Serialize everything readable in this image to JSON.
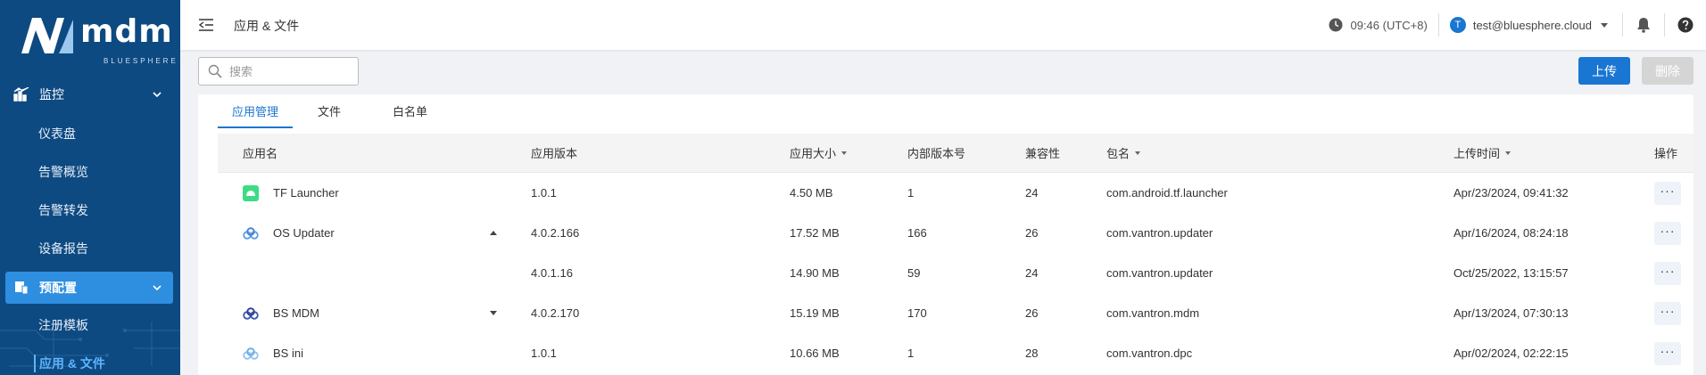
{
  "brand": {
    "name": "mdm",
    "sub": "BLUESPHERE"
  },
  "sidebar": {
    "groups": [
      {
        "label": "监控",
        "icon": "chart-icon"
      },
      {
        "label": "预配置",
        "icon": "config-icon"
      }
    ],
    "items": [
      "仪表盘",
      "告警概览",
      "告警转发",
      "设备报告",
      "注册模板",
      "应用 & 文件"
    ]
  },
  "header": {
    "title": "应用 & 文件",
    "time": "09:46 (UTC+8)",
    "user_initial": "T",
    "user_email": "test@bluesphere.cloud"
  },
  "toolbar": {
    "search_placeholder": "搜索",
    "upload_label": "上传",
    "delete_label": "删除"
  },
  "tabs": [
    "应用管理",
    "文件",
    "白名单"
  ],
  "table": {
    "columns": [
      "应用名",
      "应用版本",
      "应用大小",
      "内部版本号",
      "兼容性",
      "包名",
      "上传时间",
      "操作"
    ],
    "rows": [
      {
        "name": "TF Launcher",
        "icon": "android-icon",
        "version": "1.0.1",
        "size": "4.50 MB",
        "build": "1",
        "compat": "24",
        "package": "com.android.tf.launcher",
        "uploaded": "Apr/23/2024, 09:41:32",
        "expand": ""
      },
      {
        "name": "OS Updater",
        "icon": "cloud-icon",
        "version": "4.0.2.166",
        "size": "17.52 MB",
        "build": "166",
        "compat": "26",
        "package": "com.vantron.updater",
        "uploaded": "Apr/16/2024, 08:24:18",
        "expand": "up"
      },
      {
        "name": "",
        "icon": "",
        "version": "4.0.1.16",
        "size": "14.90 MB",
        "build": "59",
        "compat": "24",
        "package": "com.vantron.updater",
        "uploaded": "Oct/25/2022, 13:15:57",
        "expand": ""
      },
      {
        "name": "BS MDM",
        "icon": "cloud-icon",
        "version": "4.0.2.170",
        "size": "15.19 MB",
        "build": "170",
        "compat": "26",
        "package": "com.vantron.mdm",
        "uploaded": "Apr/13/2024, 07:30:13",
        "expand": "down"
      },
      {
        "name": "BS ini",
        "icon": "cloud-icon",
        "version": "1.0.1",
        "size": "10.66 MB",
        "build": "1",
        "compat": "28",
        "package": "com.vantron.dpc",
        "uploaded": "Apr/02/2024, 02:22:15",
        "expand": ""
      }
    ],
    "more_label": "···"
  },
  "colors": {
    "sidebar": "#0d4a82",
    "accent": "#1976d2",
    "active_nav": "#2e8ee0"
  }
}
